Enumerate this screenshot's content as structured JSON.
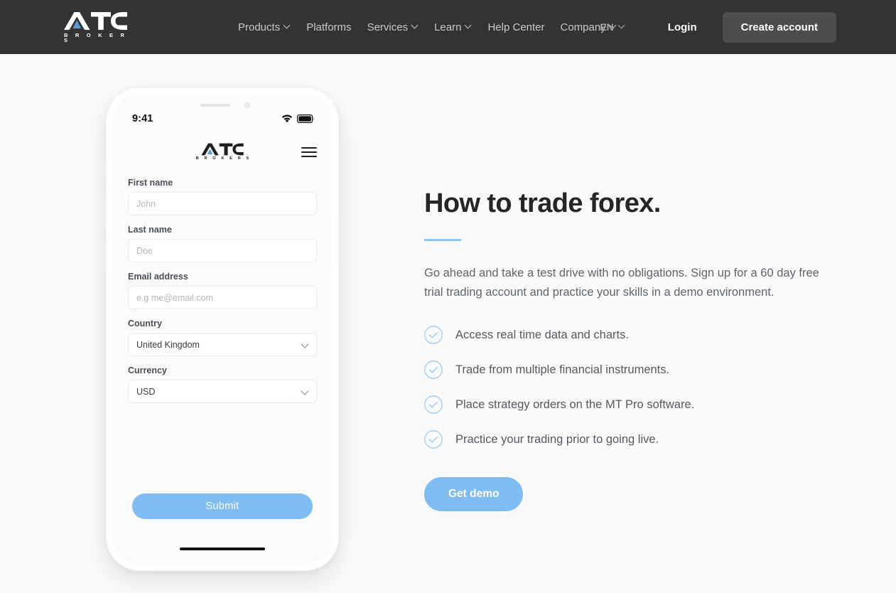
{
  "header": {
    "logo": {
      "mark_text": "ATC",
      "sub_text": "B R O K E R S",
      "accent_color": "#5b9bd5"
    },
    "nav": [
      {
        "label": "Products",
        "has_dropdown": true
      },
      {
        "label": "Platforms",
        "has_dropdown": false
      },
      {
        "label": "Services",
        "has_dropdown": true
      },
      {
        "label": "Learn",
        "has_dropdown": true
      },
      {
        "label": "Help Center",
        "has_dropdown": false
      },
      {
        "label": "Company",
        "has_dropdown": true
      }
    ],
    "language": "EN",
    "login_label": "Login",
    "create_account_label": "Create account",
    "background_color": "#333333"
  },
  "phone": {
    "status": {
      "time": "9:41"
    },
    "logo": {
      "mark_text": "ATC",
      "sub_text": "B R O K E R S"
    },
    "form": {
      "fields": [
        {
          "label": "First name",
          "placeholder": "John",
          "value": "",
          "type": "text"
        },
        {
          "label": "Last name",
          "placeholder": "Doe",
          "value": "",
          "type": "text"
        },
        {
          "label": "Email address",
          "placeholder": "e.g me@email.com",
          "value": "",
          "type": "text"
        },
        {
          "label": "Country",
          "placeholder": "",
          "value": "United Kingdom",
          "type": "select"
        },
        {
          "label": "Currency",
          "placeholder": "",
          "value": "USD",
          "type": "select"
        }
      ],
      "submit_label": "Submit"
    }
  },
  "main": {
    "title": "How to trade forex.",
    "lede": "Go ahead and take a test drive with no obligations. Sign up for a 60 day free trial trading account and practice your skills in a demo environment.",
    "checklist": [
      "Access real time data and charts.",
      "Trade from multiple financial instruments.",
      "Place strategy orders on the MT Pro software.",
      "Practice your trading prior to going live."
    ],
    "cta_label": "Get demo",
    "accent_color": "#7fbcf2",
    "rule_color": "#8dc5f4"
  }
}
